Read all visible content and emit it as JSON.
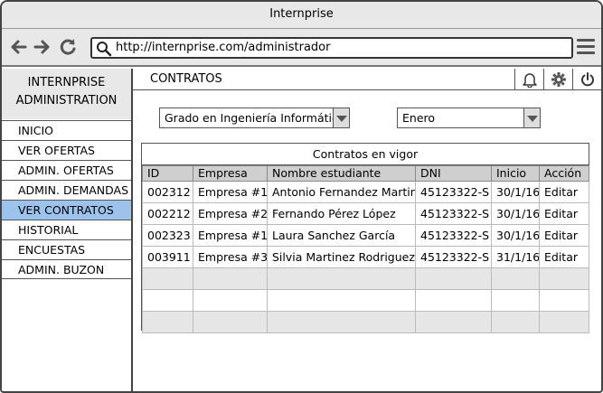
{
  "window": {
    "title": "Internprise"
  },
  "browser": {
    "url": "http://internprise.com/administrador",
    "back_icon": "arrow-left-icon",
    "forward_icon": "arrow-right-icon",
    "reload_icon": "reload-icon",
    "search_icon": "magnifier-icon",
    "menu_icon": "hamburger-menu-icon"
  },
  "sidebar": {
    "title_line1": "INTERNPRISE",
    "title_line2": "ADMINISTRATION",
    "items": [
      {
        "label": "INICIO"
      },
      {
        "label": "VER OFERTAS"
      },
      {
        "label": "ADMIN. OFERTAS"
      },
      {
        "label": "ADMIN. DEMANDAS"
      },
      {
        "label": "VER CONTRATOS",
        "active": true
      },
      {
        "label": "HISTORIAL"
      },
      {
        "label": "ENCUESTAS"
      },
      {
        "label": "ADMIN. BUZON"
      }
    ]
  },
  "header": {
    "title": "CONTRATOS",
    "icons": [
      "bell-icon",
      "gear-icon",
      "power-icon"
    ]
  },
  "filters": {
    "degree": "Grado en Ingeniería Informática",
    "month": "Enero"
  },
  "contracts_table": {
    "caption": "Contratos en vigor",
    "columns": [
      "ID",
      "Empresa",
      "Nombre estudiante",
      "DNI",
      "Inicio",
      "Acción"
    ],
    "rows": [
      [
        "002312",
        "Empresa #1",
        "Antonio Fernandez Martin",
        "45123322-S",
        "30/1/16",
        "Editar"
      ],
      [
        "002212",
        "Empresa #2",
        "Fernando Pérez López",
        "45123322-S",
        "30/1/16",
        "Editar"
      ],
      [
        "002323",
        "Empresa #1",
        "Laura Sanchez García",
        "45123322-S",
        "30/1/16",
        "Editar"
      ],
      [
        "003911",
        "Empresa #3",
        "Silvia Martinez Rodriguez",
        "45123322-S",
        "31/1/16",
        "Editar"
      ]
    ]
  },
  "colors": {
    "active_item": "#9cc3ec",
    "header_bg": "#cfcfcf",
    "chrome_bg": "#e8e8e8"
  }
}
